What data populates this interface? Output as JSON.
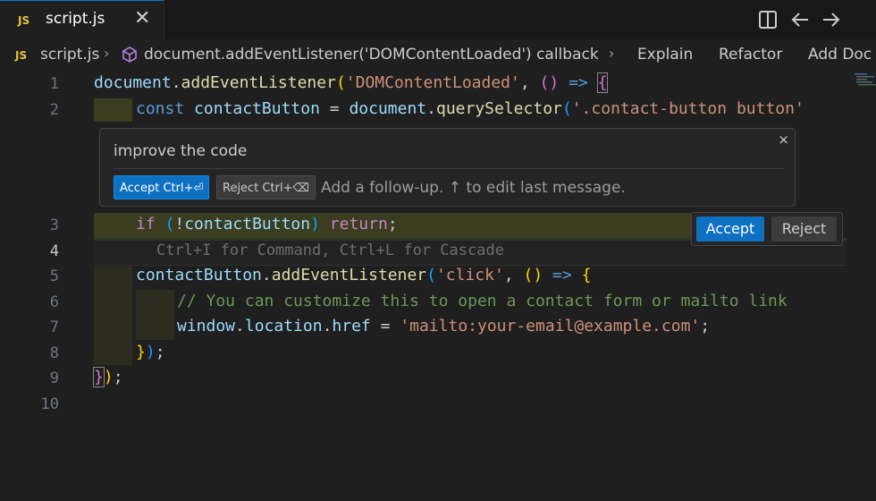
{
  "tab": {
    "icon": "JS",
    "label": "script.js",
    "close": "✕"
  },
  "title_actions": [
    "split-editor-icon",
    "go-back-icon"
  ],
  "breadcrumb": {
    "file_icon": "JS",
    "file": "script.js",
    "symbol": "document.addEventListener('DOMContentLoaded') callback",
    "actions": [
      "Explain",
      "Refactor",
      "Add Doc"
    ]
  },
  "line_numbers": [
    "1",
    "2",
    "3",
    "4",
    "5",
    "6",
    "7",
    "8",
    "9",
    "10"
  ],
  "code": {
    "l1": {
      "a": "document",
      "b": ".",
      "c": "addEventListener",
      "d": "(",
      "e": "'DOMContentLoaded'",
      "f": ", ",
      "g": "()",
      "h": " => ",
      "i": "{"
    },
    "l2": {
      "a": "const",
      "b": " ",
      "c": "contactButton",
      "d": " = ",
      "e": "document",
      "f": ".",
      "g": "querySelector",
      "h": "(",
      "i": "'.contact-button button'"
    },
    "l3": {
      "a": "if",
      "b": " ",
      "c": "(",
      "d": "!",
      "e": "contactButton",
      "f": ")",
      "g": " ",
      "h": "return",
      "i": ";"
    },
    "l4_ghost": "Ctrl+I for Command, Ctrl+L for Cascade",
    "l5": {
      "a": "contactButton",
      "b": ".",
      "c": "addEventListener",
      "d": "(",
      "e": "'click'",
      "f": ", ",
      "g": "()",
      "h": " => ",
      "i": "{"
    },
    "l6": "// You can customize this to open a contact form or mailto link",
    "l7": {
      "a": "window",
      "b": ".",
      "c": "location",
      "d": ".",
      "e": "href",
      "f": " = ",
      "g": "'mailto:your-email@example.com'",
      "h": ";"
    },
    "l8": {
      "a": "}",
      "b": ")",
      "c": ";"
    },
    "l9": {
      "a": "}",
      "b": ")",
      "c": ";"
    }
  },
  "chat": {
    "prompt": "improve the code",
    "close": "×",
    "accept_label": "Accept Ctrl+⏎",
    "reject_label": "Reject Ctrl+⌫",
    "followup_placeholder": "Add a follow-up. ↑ to edit last message."
  },
  "diff_actions": {
    "accept": "Accept",
    "reject": "Reject"
  },
  "colors": {
    "accent": "#0e70c0",
    "diff_highlight": "#3a3d1f",
    "js_icon": "#e8c33a"
  }
}
